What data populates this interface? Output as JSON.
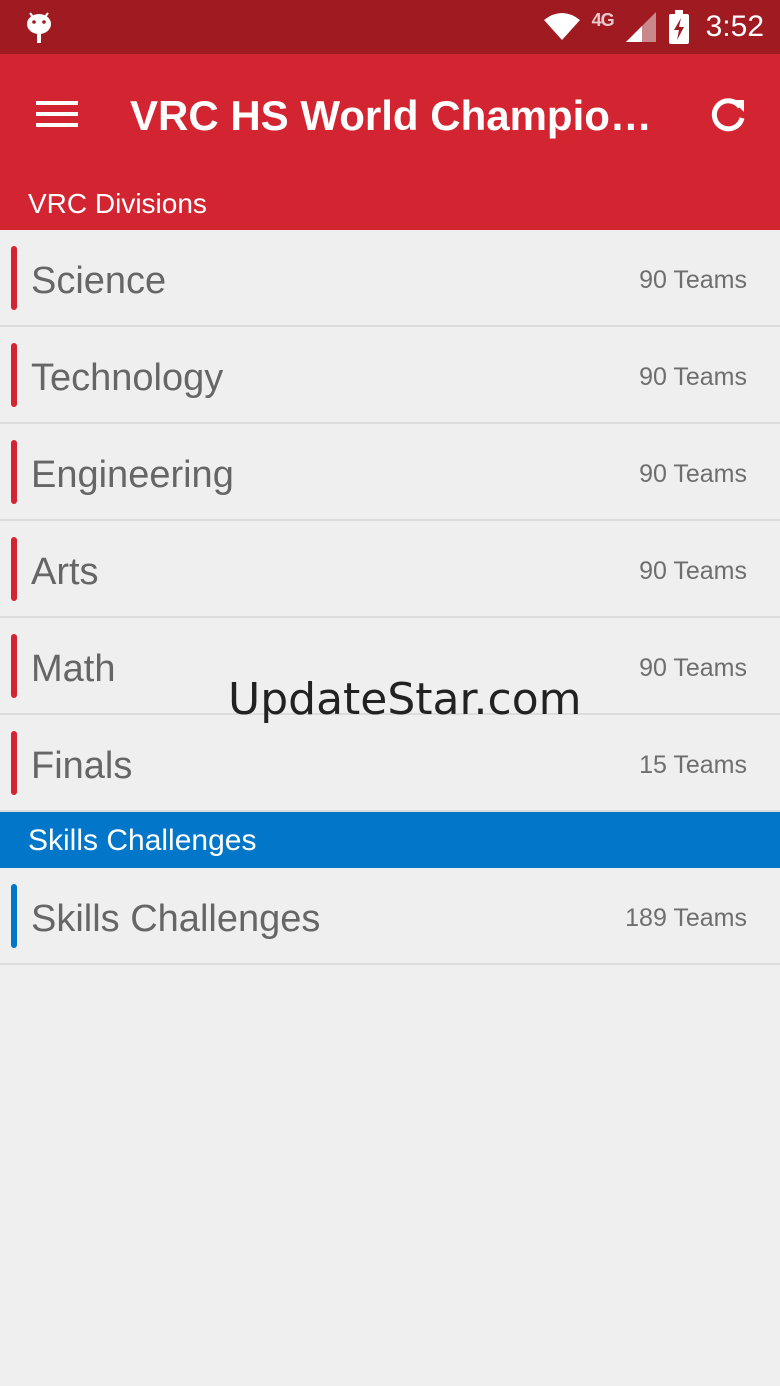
{
  "status_bar": {
    "time": "3:52",
    "network_type": "4G",
    "icons": [
      "android-debug-icon",
      "wifi-icon",
      "signal-icon",
      "battery-charging-icon"
    ]
  },
  "app_bar": {
    "title": "VRC HS World Champions…",
    "menu_icon": "hamburger-menu-icon",
    "refresh_icon": "refresh-icon"
  },
  "divisions": {
    "header": "VRC Divisions",
    "accent_color": "#d32431",
    "items": [
      {
        "name": "Science",
        "count": "90 Teams"
      },
      {
        "name": "Technology",
        "count": "90 Teams"
      },
      {
        "name": "Engineering",
        "count": "90 Teams"
      },
      {
        "name": "Arts",
        "count": "90 Teams"
      },
      {
        "name": "Math",
        "count": "90 Teams"
      },
      {
        "name": "Finals",
        "count": "15 Teams"
      }
    ]
  },
  "skills": {
    "header": "Skills Challenges",
    "accent_color": "#0277c9",
    "items": [
      {
        "name": "Skills Challenges",
        "count": "189 Teams"
      }
    ]
  },
  "watermark": "UpdateStar.com"
}
